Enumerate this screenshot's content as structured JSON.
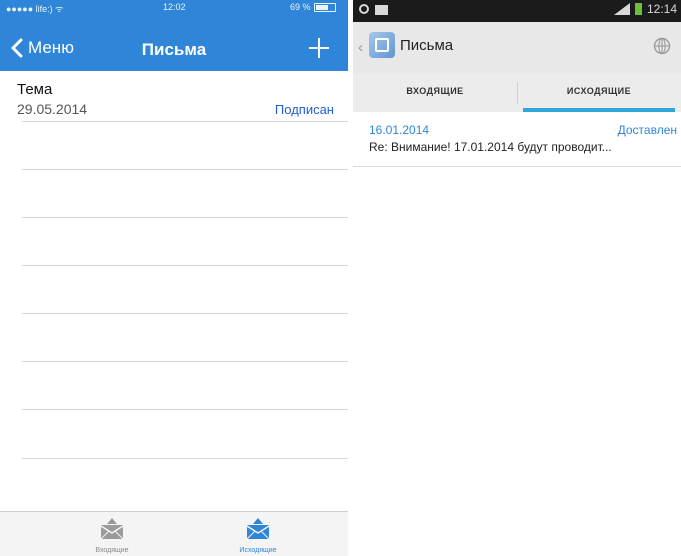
{
  "ios": {
    "status_bar": {
      "carrier": "●●●●● life:) ᯤ",
      "time": "12:02",
      "battery": "69 %",
      "battery_level": 0.69
    },
    "nav": {
      "back_label": "Меню",
      "title": "Письма",
      "add_icon": "plus-icon",
      "back_icon": "chevron-left-icon"
    },
    "list": {
      "items": [
        {
          "subject": "Тема",
          "date": "29.05.2014",
          "status": "Подписан"
        }
      ]
    },
    "tab_bar": {
      "tabs": [
        {
          "label": "Входящие",
          "icon": "envelope-icon",
          "selected": false
        },
        {
          "label": "Исходящие",
          "icon": "envelope-icon",
          "selected": true
        }
      ]
    },
    "colors": {
      "accent": "#2f86d8",
      "status_link": "#1f5fd1"
    }
  },
  "android": {
    "status_bar": {
      "time": "12:14"
    },
    "action_bar": {
      "up_icon": "chevron-left-icon",
      "app_icon": "app-icon",
      "title": "Письма",
      "menu_icon": "globe-icon"
    },
    "tabs": [
      {
        "label": "ВХОДЯЩИЕ",
        "selected": false
      },
      {
        "label": "ИСХОДЯЩИЕ",
        "selected": true
      }
    ],
    "list": {
      "items": [
        {
          "date": "16.01.2014",
          "status": "Доставлен",
          "subject": "Re: Внимание! 17.01.2014 будут проводит..."
        }
      ]
    },
    "colors": {
      "accent": "#2fa8d8",
      "link": "#2f86d8"
    }
  }
}
